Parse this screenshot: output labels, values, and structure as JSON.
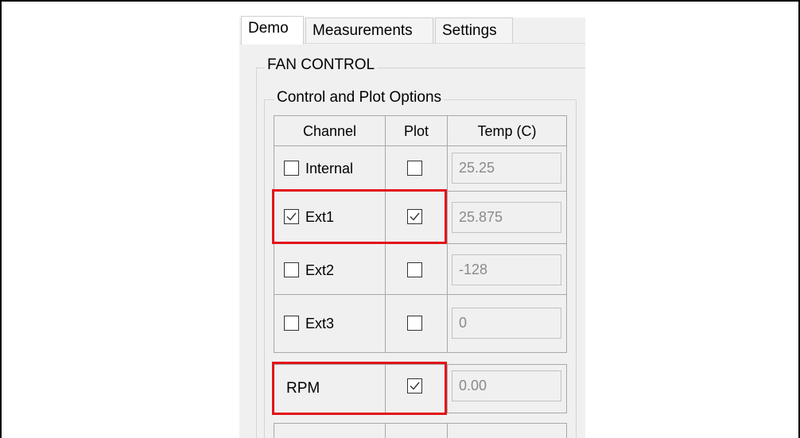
{
  "tabs": [
    {
      "label": "Demo",
      "active": true
    },
    {
      "label": "Measurements",
      "active": false
    },
    {
      "label": "Settings",
      "active": false
    }
  ],
  "fan_control": {
    "title": "FAN CONTROL"
  },
  "options": {
    "title": "Control and Plot Options",
    "headers": {
      "channel": "Channel",
      "plot": "Plot",
      "temp": "Temp (C)"
    },
    "rows": [
      {
        "channel": "Internal",
        "channel_checked": false,
        "plot_checked": false,
        "temp": "25.25"
      },
      {
        "channel": "Ext1",
        "channel_checked": true,
        "plot_checked": true,
        "temp": "25.875"
      },
      {
        "channel": "Ext2",
        "channel_checked": false,
        "plot_checked": false,
        "temp": "-128"
      },
      {
        "channel": "Ext3",
        "channel_checked": false,
        "plot_checked": false,
        "temp": "0"
      }
    ],
    "rpm": {
      "label": "RPM",
      "plot_checked": true,
      "value": "0.00"
    }
  },
  "colors": {
    "highlight": "#e2131a",
    "window_bg": "#f0f0f0"
  }
}
